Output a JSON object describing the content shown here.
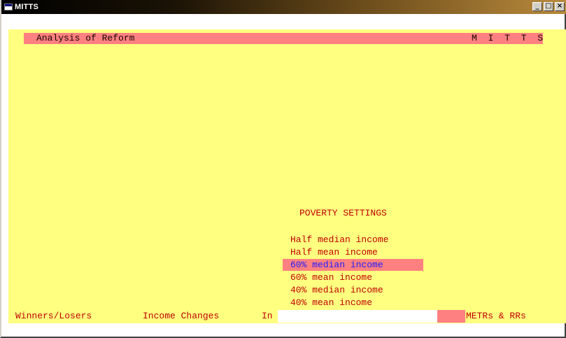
{
  "window": {
    "title": "MITTS"
  },
  "header": {
    "title": "Analysis of Reform",
    "brand": "M I T T S"
  },
  "poverty": {
    "title": "POVERTY SETTINGS",
    "options": [
      {
        "label": "Half median income",
        "selected": false
      },
      {
        "label": "Half mean income",
        "selected": false
      },
      {
        "label": "60% median income",
        "selected": true
      },
      {
        "label": "60% mean income",
        "selected": false
      },
      {
        "label": "40% median income",
        "selected": false
      },
      {
        "label": "40% mean income",
        "selected": false
      }
    ]
  },
  "bottom_menu": {
    "winners": "Winners/Losers",
    "income": "Income Changes",
    "in": "In",
    "metrs": "METRs & RRs"
  },
  "colors": {
    "background": "#ffff80",
    "highlight": "#ff8080",
    "text": "#c00000",
    "selected_text": "#1a1aff"
  }
}
